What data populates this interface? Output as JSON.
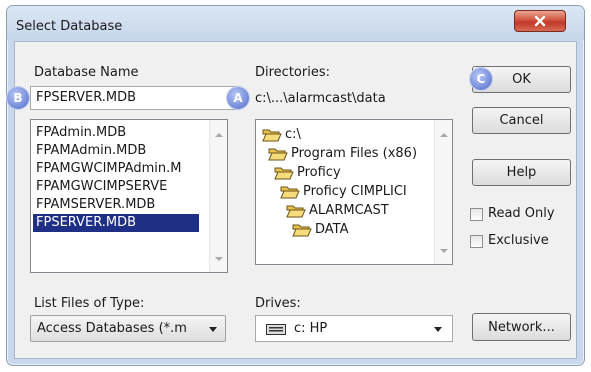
{
  "window": {
    "title": "Select Database",
    "close_icon": "close-icon"
  },
  "badges": {
    "a": "A",
    "b": "B",
    "c": "C"
  },
  "database_name": {
    "label": "Database Name",
    "value": "FPSERVER.MDB",
    "files": [
      "FPAdmin.MDB",
      "FPAMAdmin.MDB",
      "FPAMGWCIMPAdmin.M",
      "FPAMGWCIMPSERVE",
      "FPAMSERVER.MDB",
      "FPSERVER.MDB"
    ],
    "selected_index": 5
  },
  "directories": {
    "label": "Directories:",
    "current_path": "c:\\...\\alarmcast\\data",
    "tree": [
      "c:\\",
      "Program Files (x86)",
      "Proficy",
      "Proficy CIMPLICI",
      "ALARMCAST",
      "DATA"
    ]
  },
  "file_type": {
    "label": "List Files of Type:",
    "value": "Access Databases (*.m"
  },
  "drives": {
    "label": "Drives:",
    "value": "c: HP"
  },
  "buttons": {
    "ok": "OK",
    "cancel": "Cancel",
    "help": "Help",
    "network": "Network..."
  },
  "options": {
    "read_only": "Read Only",
    "exclusive": "Exclusive",
    "read_only_checked": false,
    "exclusive_checked": false
  }
}
